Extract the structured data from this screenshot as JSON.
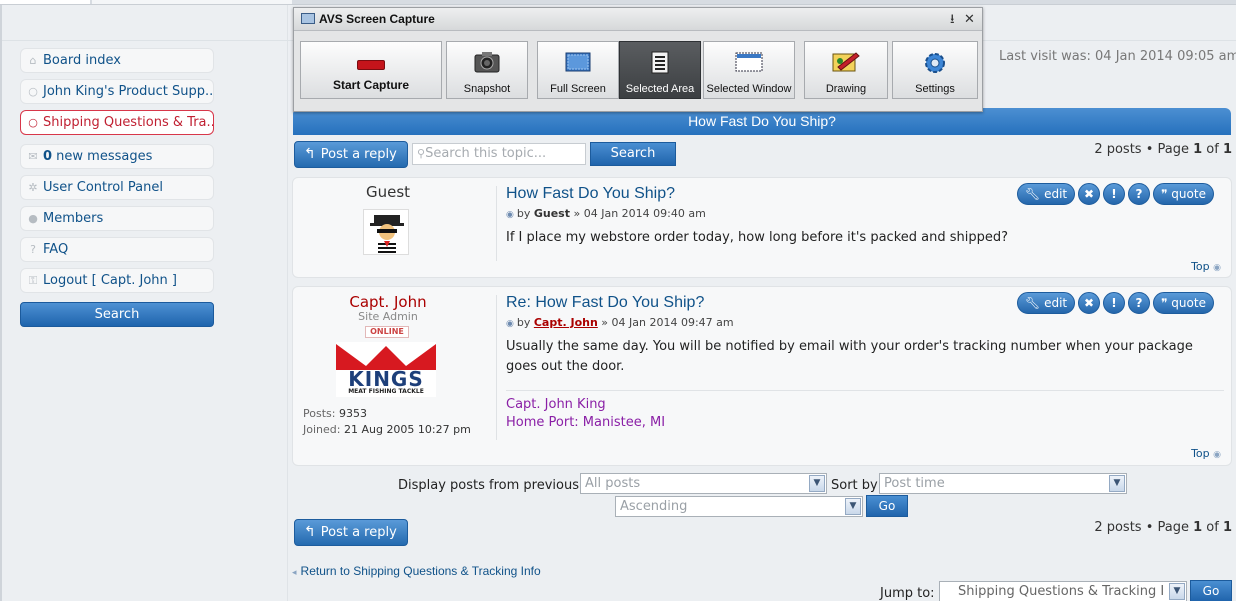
{
  "avs": {
    "title": "AVS Screen Capture",
    "buttons": [
      {
        "label": "Start Capture",
        "icon": "record-icon"
      },
      {
        "label": "Snapshot",
        "icon": "camera-icon"
      },
      {
        "label": "Full Screen",
        "icon": "full-screen-icon"
      },
      {
        "label": "Selected Area",
        "icon": "selected-area-icon",
        "selected": true
      },
      {
        "label": "Selected Window",
        "icon": "window-icon"
      },
      {
        "label": "Drawing",
        "icon": "drawing-icon"
      },
      {
        "label": "Settings",
        "icon": "gear-icon"
      }
    ]
  },
  "sidebar": {
    "items": [
      {
        "label": "Board index",
        "icon": "home-icon"
      },
      {
        "label": "John King's Product Supp...",
        "icon": "speech-bubble-icon"
      },
      {
        "label": "Shipping Questions & Tra...",
        "icon": "speech-bubble-icon",
        "active": true
      },
      {
        "count": "0",
        "label": " new messages",
        "icon": "envelope-icon"
      },
      {
        "label": "User Control Panel",
        "icon": "gear-icon"
      },
      {
        "label": "Members",
        "icon": "user-icon"
      },
      {
        "label": "FAQ",
        "icon": "question-icon"
      },
      {
        "label": "Logout [ Capt. John ]",
        "icon": "key-icon"
      }
    ],
    "search_label": "Search"
  },
  "header": {
    "last_visit": "Last visit was: 04 Jan 2014 09:05 am"
  },
  "topic": {
    "title": "How Fast Do You Ship?",
    "post_reply": "Post a reply",
    "search_placeholder": "Search this topic...",
    "search_button": "Search",
    "pagination": {
      "posts": "2 posts • Page ",
      "page": "1",
      "of": " of ",
      "total": "1"
    }
  },
  "posts": [
    {
      "author": "Guest",
      "title": "How Fast Do You Ship?",
      "by_prefix": "by ",
      "author_link": "Guest",
      "date": " » 04 Jan 2014 09:40 am",
      "body": "If I place my webstore order today, how long before it's packed and shipped?",
      "top": "Top"
    },
    {
      "author": "Capt. John",
      "rank": "Site Admin",
      "online": "ONLINE",
      "logo_top": "KINGS",
      "logo_sub": "MEAT FISHING TACKLE",
      "posts_label": "Posts:",
      "posts_count": "9353",
      "joined_label": "Joined:",
      "joined": "21 Aug 2005 10:27 pm",
      "title": "Re: How Fast Do You Ship?",
      "by_prefix": "by ",
      "author_link": "Capt. John",
      "date": " » 04 Jan 2014 09:47 am",
      "body": "Usually the same day. You will be notified by email with your order's tracking number when your package goes out the door.",
      "sig_line1": "Capt. John King",
      "sig_line2": "Home Port: Manistee, MI",
      "top": "Top"
    }
  ],
  "post_actions": {
    "edit": "edit",
    "quote": "quote"
  },
  "filters": {
    "display_label": "Display posts from previous:",
    "display_value": "All posts",
    "sort_label": "Sort by",
    "sort_value": "Post time",
    "order_value": "Ascending",
    "go": "Go"
  },
  "footer": {
    "return_link": "Return to Shipping Questions & Tracking Info",
    "jump_label": "Jump to:",
    "jump_value": "Shipping Questions & Tracking I",
    "go": "Go"
  },
  "colors": {
    "link": "#105289",
    "accent_blue": "#2671bd",
    "admin_red": "#aa0000",
    "signature": "#8a1fa6"
  }
}
